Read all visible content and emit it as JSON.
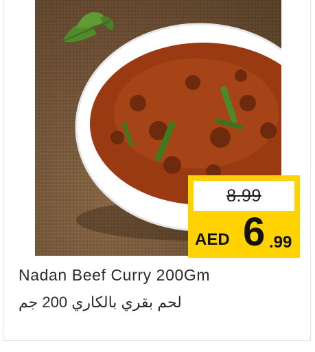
{
  "product": {
    "name_en": "Nadan Beef Curry 200Gm",
    "name_ar": "لحم بقري بالكاري 200 جم",
    "image_alt_icon": "beef-curry-bowl-photo"
  },
  "price": {
    "old": "8.99",
    "currency": "AED",
    "main": "6",
    "cents": ".99"
  },
  "colors": {
    "price_tag_yellow": "#ffd200",
    "curry": "#9a3a12",
    "bowl": "#ffffff"
  }
}
